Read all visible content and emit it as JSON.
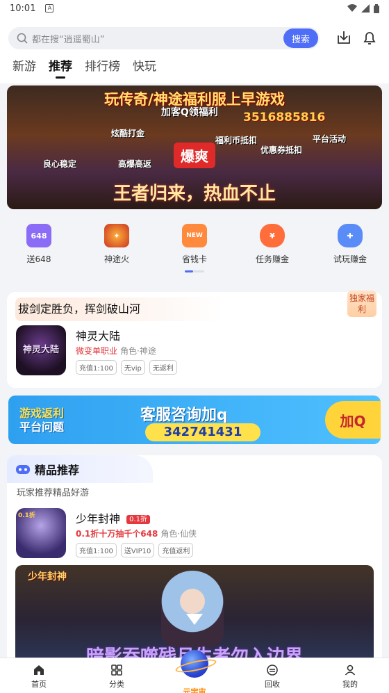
{
  "status_bar": {
    "time": "10:01",
    "app_badge": "A"
  },
  "header": {
    "search_placeholder": "都在搜“逍遥蜀山”",
    "search_button": "搜索",
    "tabs": [
      {
        "label": "新游",
        "active": false
      },
      {
        "label": "推荐",
        "active": true
      },
      {
        "label": "排行榜",
        "active": false
      },
      {
        "label": "快玩",
        "active": false
      }
    ]
  },
  "banner": {
    "title": "玩传奇/神途福利服上早游戏",
    "subtitle": "加客Q领福利",
    "phone": "3516885816",
    "tags": [
      "炫酷打金",
      "福利币抵扣",
      "平台活动",
      "良心稳定",
      "高爆高返",
      "优惠券抵扣"
    ],
    "center_badge": "爆爽",
    "slogan": "王者归来，热血不止"
  },
  "features": [
    {
      "label": "送648",
      "icon": "gift-648-icon",
      "badge": "648",
      "color": "#8a6cf6"
    },
    {
      "label": "神途火",
      "icon": "flame-game-icon",
      "color": "#c9341f"
    },
    {
      "label": "省钱卡",
      "icon": "saving-card-icon",
      "badge": "NEW",
      "color": "#ff8a3d"
    },
    {
      "label": "任务赚金",
      "icon": "money-bag-icon",
      "color": "#ff6d3a"
    },
    {
      "label": "试玩赚金",
      "icon": "gamepad-icon",
      "color": "#5a8cf7"
    }
  ],
  "promo": {
    "title": "拔剑定胜负，挥剑破山河",
    "exclusive_badge": "独家福利",
    "game": {
      "name": "神灵大陆",
      "icon_text": "神灵大陆",
      "highlight": "微变单职业",
      "genre": "角色·神途",
      "chips": [
        "充值1:100",
        "无vip",
        "无返利"
      ]
    }
  },
  "ad": {
    "left_line1": "游戏返利",
    "left_line2": "平台问题",
    "middle": "客服咨询加q",
    "number": "342741431",
    "button": "加Q"
  },
  "recommend": {
    "title": "精品推荐",
    "subtitle": "玩家推荐精品好游",
    "game": {
      "name": "少年封神",
      "discount_badge": "0.1折",
      "icon_badge": "0.1折",
      "highlight": "0.1折十万抽千个648",
      "genre": "角色·仙侠",
      "chips": [
        "充值1:100",
        "送VIP10",
        "充值返利"
      ]
    },
    "video": {
      "title": "少年封神",
      "caption": "暗影吞噬残月生者勿入边界"
    }
  },
  "bottom_nav": [
    {
      "label": "首页",
      "icon": "home-icon"
    },
    {
      "label": "分类",
      "icon": "grid-icon"
    },
    {
      "label": "元宇宙",
      "icon": "planet-icon"
    },
    {
      "label": "回收",
      "icon": "recycle-icon"
    },
    {
      "label": "我的",
      "icon": "user-icon"
    }
  ]
}
